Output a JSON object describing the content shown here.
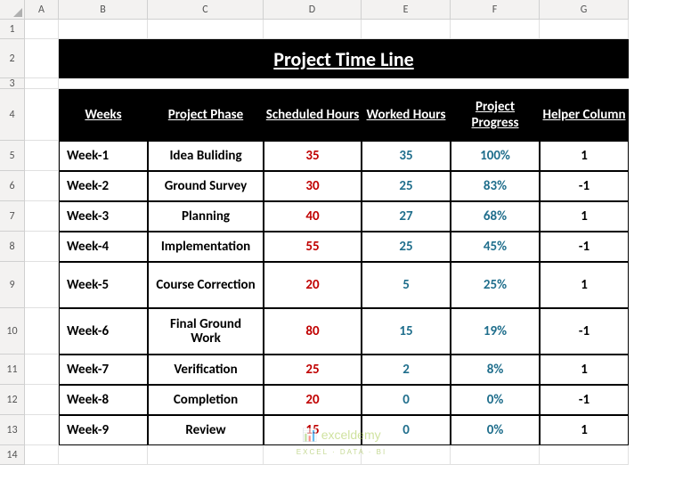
{
  "columns": [
    "A",
    "B",
    "C",
    "D",
    "E",
    "F",
    "G"
  ],
  "row_labels": [
    "1",
    "2",
    "3",
    "4",
    "5",
    "6",
    "7",
    "8",
    "9",
    "10",
    "11",
    "12",
    "13",
    "14"
  ],
  "title": "Project Time Line",
  "headers": {
    "weeks": "Weeks",
    "phase": "Project Phase",
    "scheduled": "Scheduled Hours",
    "worked": "Worked Hours",
    "progress": "Project Progress",
    "helper": "Helper Column"
  },
  "rows": [
    {
      "week": "Week-1",
      "phase": "Idea Buliding",
      "scheduled": "35",
      "worked": "35",
      "progress": "100%",
      "helper": "1"
    },
    {
      "week": "Week-2",
      "phase": "Ground Survey",
      "scheduled": "30",
      "worked": "25",
      "progress": "83%",
      "helper": "-1"
    },
    {
      "week": "Week-3",
      "phase": "Planning",
      "scheduled": "40",
      "worked": "27",
      "progress": "68%",
      "helper": "1"
    },
    {
      "week": "Week-4",
      "phase": "Implementation",
      "scheduled": "55",
      "worked": "25",
      "progress": "45%",
      "helper": "-1"
    },
    {
      "week": "Week-5",
      "phase": "Course Correction",
      "scheduled": "20",
      "worked": "5",
      "progress": "25%",
      "helper": "1"
    },
    {
      "week": "Week-6",
      "phase": "Final Ground Work",
      "scheduled": "80",
      "worked": "15",
      "progress": "19%",
      "helper": "-1"
    },
    {
      "week": "Week-7",
      "phase": "Verification",
      "scheduled": "25",
      "worked": "2",
      "progress": "8%",
      "helper": "1"
    },
    {
      "week": "Week-8",
      "phase": "Completion",
      "scheduled": "20",
      "worked": "0",
      "progress": "0%",
      "helper": "-1"
    },
    {
      "week": "Week-9",
      "phase": "Review",
      "scheduled": "15",
      "worked": "0",
      "progress": "0%",
      "helper": "1"
    }
  ],
  "watermark": {
    "main": "exceldemy",
    "sub": "EXCEL · DATA · BI"
  },
  "chart_data": {
    "type": "table",
    "title": "Project Time Line",
    "columns": [
      "Weeks",
      "Project Phase",
      "Scheduled Hours",
      "Worked Hours",
      "Project Progress",
      "Helper Column"
    ],
    "data": [
      [
        "Week-1",
        "Idea Buliding",
        35,
        35,
        "100%",
        1
      ],
      [
        "Week-2",
        "Ground Survey",
        30,
        25,
        "83%",
        -1
      ],
      [
        "Week-3",
        "Planning",
        40,
        27,
        "68%",
        1
      ],
      [
        "Week-4",
        "Implementation",
        55,
        25,
        "45%",
        -1
      ],
      [
        "Week-5",
        "Course Correction",
        20,
        5,
        "25%",
        1
      ],
      [
        "Week-6",
        "Final Ground Work",
        80,
        15,
        "19%",
        -1
      ],
      [
        "Week-7",
        "Verification",
        25,
        2,
        "8%",
        1
      ],
      [
        "Week-8",
        "Completion",
        20,
        0,
        "0%",
        -1
      ],
      [
        "Week-9",
        "Review",
        15,
        0,
        "0%",
        1
      ]
    ]
  }
}
